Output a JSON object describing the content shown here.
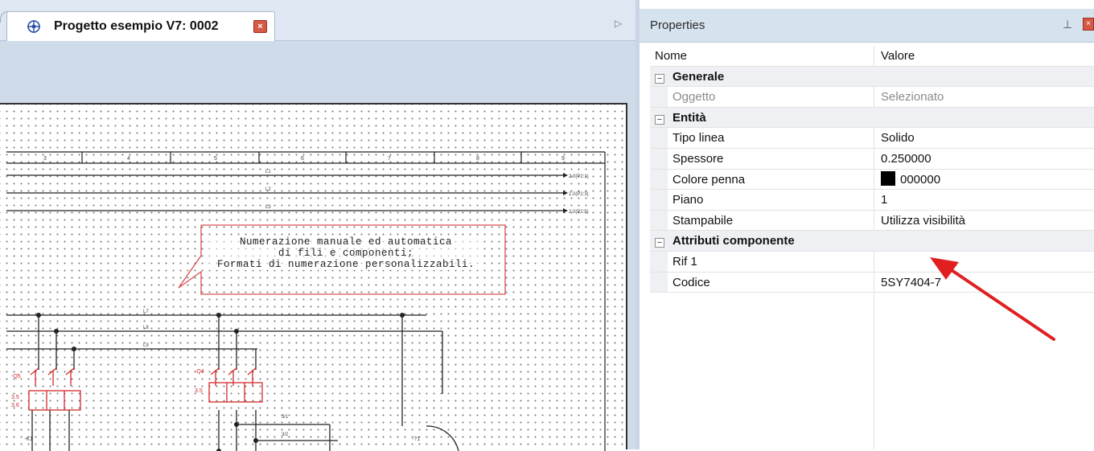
{
  "document": {
    "tab_title": "Progetto esempio V7: 0002",
    "tab_close": "×",
    "tab_scroll": "▷",
    "note_lines": [
      "Numerazione manuale ed automatica",
      "di fili e componenti;",
      "Formati di numerazione personalizzabili."
    ]
  },
  "properties": {
    "title": "Properties",
    "pin_icon": "pin-icon",
    "close": "×",
    "columns": {
      "name": "Nome",
      "value": "Valore"
    },
    "groups": [
      {
        "label": "Generale",
        "expander": "−",
        "rows": [
          {
            "name": "Oggetto",
            "value": "Selezionato",
            "readonly": true
          }
        ]
      },
      {
        "label": "Entità",
        "expander": "−",
        "rows": [
          {
            "name": "Tipo linea",
            "value": "Solido"
          },
          {
            "name": "Spessore",
            "value": "0.250000"
          },
          {
            "name": "Colore penna",
            "value": "000000",
            "swatch": "#000000"
          },
          {
            "name": "Piano",
            "value": "1"
          },
          {
            "name": "Stampabile",
            "value": "Utilizza visibilità"
          }
        ]
      },
      {
        "label": "Attributi componente",
        "expander": "−",
        "rows": [
          {
            "name": "Rif 1",
            "value": ""
          },
          {
            "name": "Codice",
            "value": "5SY7404-7"
          }
        ]
      }
    ]
  },
  "colors": {
    "accent_red": "#e02020",
    "schematic_red": "#d42a2a",
    "panel_header": "#d7e2ef",
    "doc_background": "#cfdbe9"
  }
}
